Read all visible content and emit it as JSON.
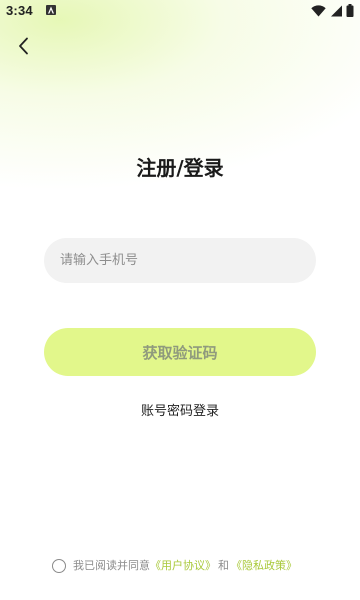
{
  "status_bar": {
    "time": "3:34",
    "notification_icon": "app-notification-icon",
    "wifi_icon": "wifi-icon",
    "signal_icon": "signal-icon",
    "battery_icon": "battery-icon"
  },
  "nav": {
    "back_icon": "back-arrow-icon"
  },
  "page": {
    "title": "注册/登录"
  },
  "form": {
    "phone_placeholder": "请输入手机号",
    "phone_value": "",
    "get_code_label": "获取验证码",
    "password_login_label": "账号密码登录"
  },
  "agreement": {
    "checked": false,
    "prefix": "我已阅读并同意",
    "user_agreement": "《用户协议》",
    "and": "和",
    "privacy_policy": "《隐私政策》"
  },
  "colors": {
    "accent": "#e2f78b",
    "accent_text": "#8f9a7d",
    "link": "#a9c93a"
  }
}
